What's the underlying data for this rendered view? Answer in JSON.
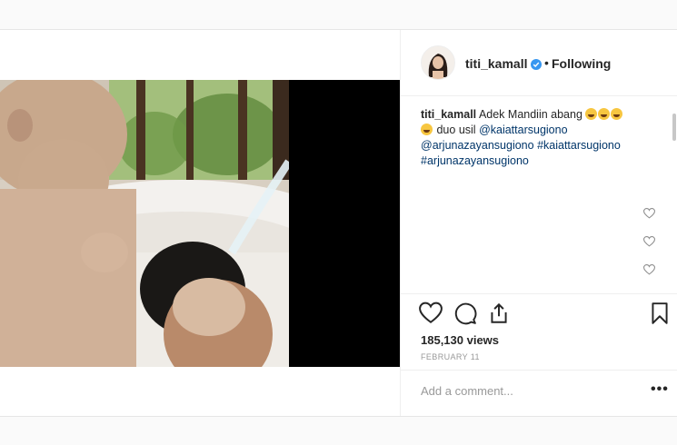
{
  "post": {
    "username": "titi_kamall",
    "verified": true,
    "separator": "•",
    "follow_label": "Following",
    "caption": {
      "username": "titi_kamall",
      "text_main": "Adek Mandiin abang",
      "text_after": "duo usil",
      "mention_1": "@kaiattarsugiono",
      "mention_2": "@arjunazayansugiono",
      "hashtag_1": "#kaiattarsugiono",
      "hashtag_2": "#arjunazayansugiono",
      "emojis": [
        "grinning-squinting-face",
        "grinning-squinting-face",
        "grinning-squinting-face",
        "grinning-squinting-face"
      ]
    },
    "views": "185,130 views",
    "date": "FEBRUARY 11",
    "comment_placeholder": "Add a comment...",
    "more_label": "•••"
  },
  "icons": {
    "like": "heart-icon",
    "comment": "comment-icon",
    "share": "share-icon",
    "save": "bookmark-icon",
    "verified": "verified-badge-icon",
    "comment_like": "small-heart-icon"
  },
  "colors": {
    "link": "#003569",
    "verified": "#3897f0",
    "muted": "#999999",
    "text": "#262626"
  }
}
